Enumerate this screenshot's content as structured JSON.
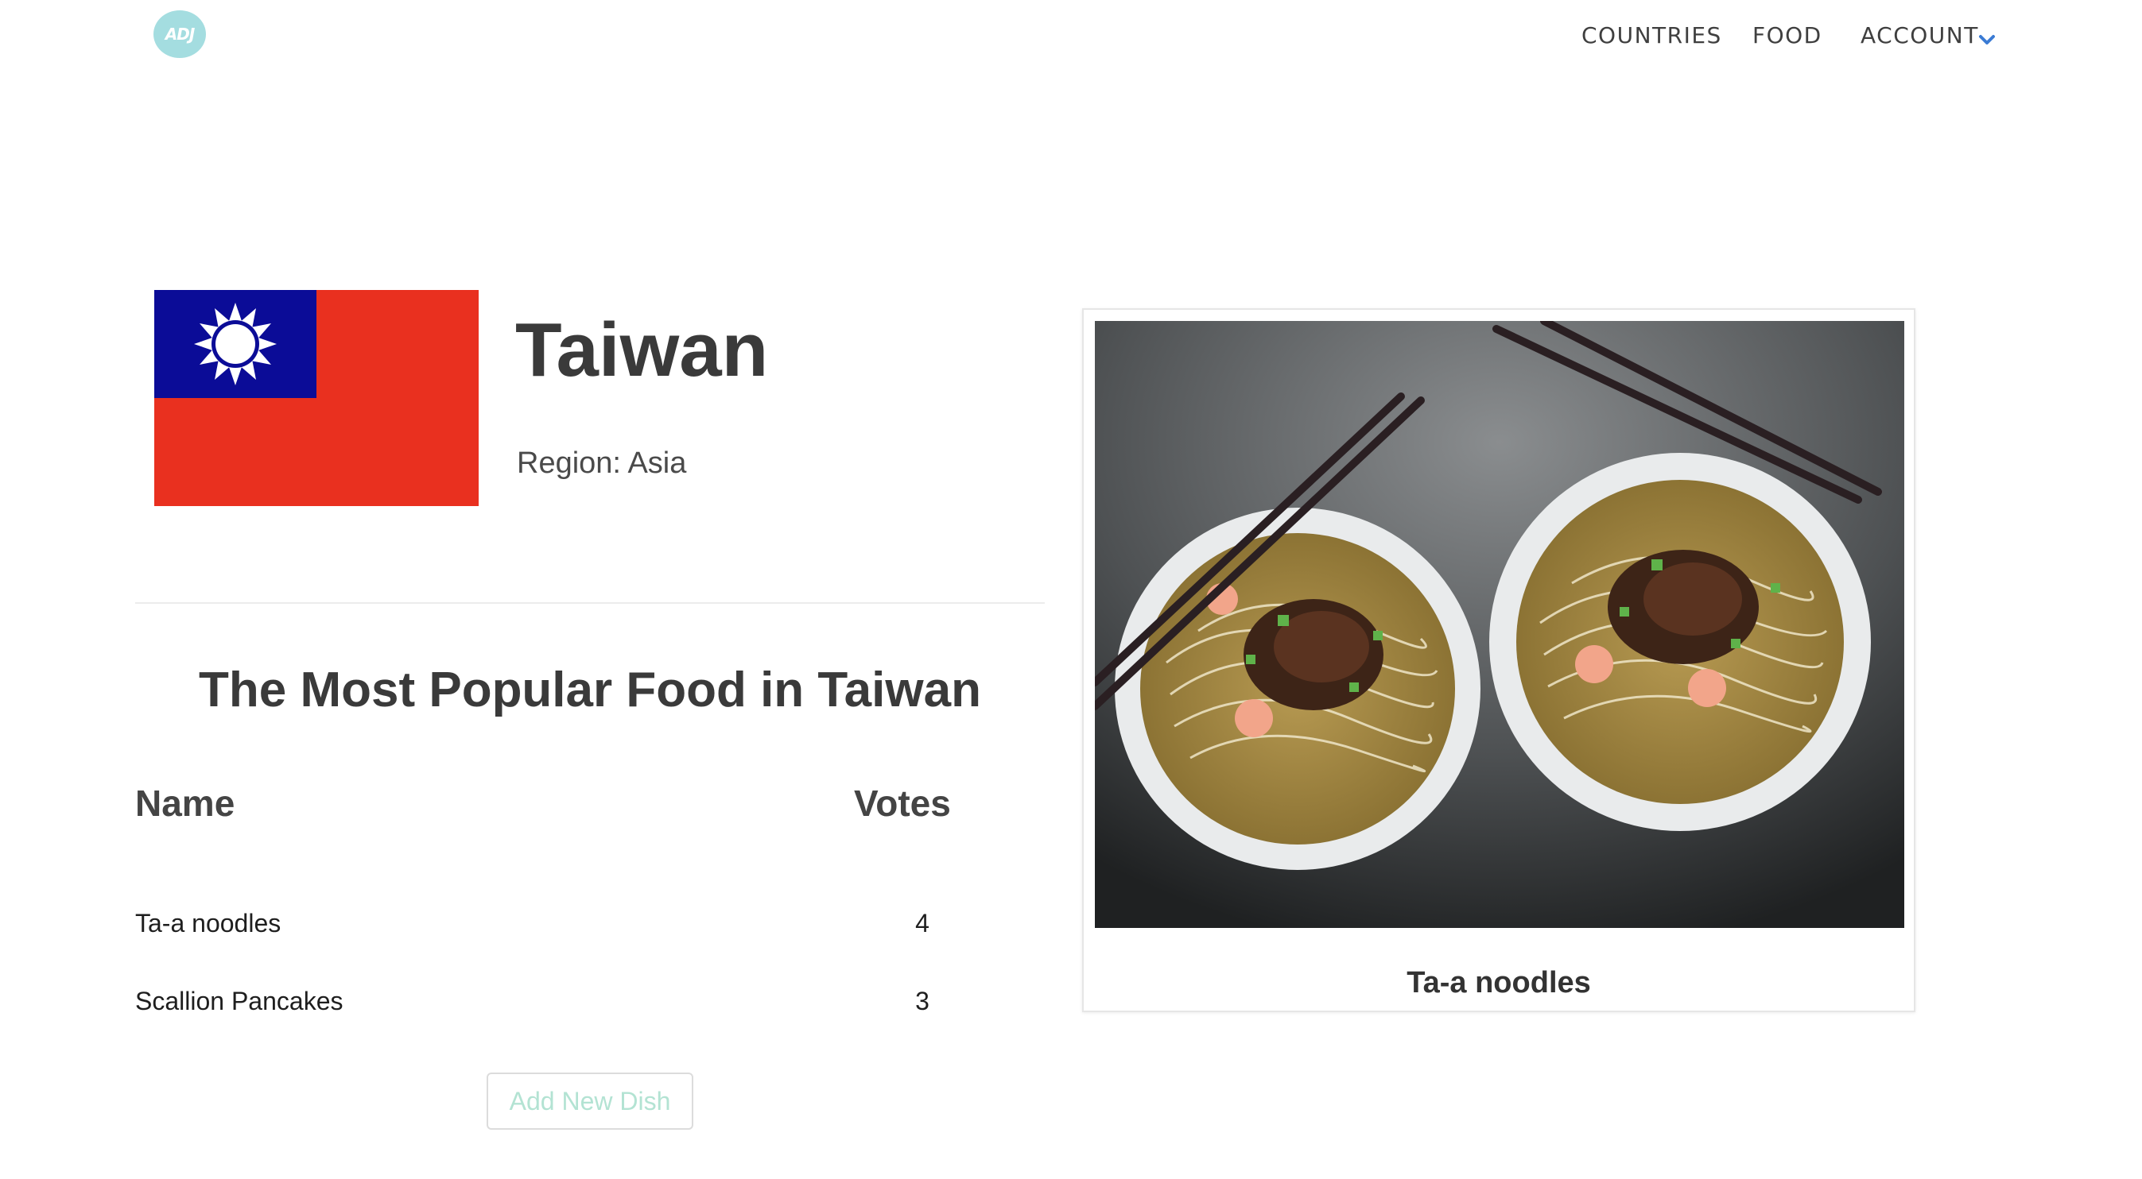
{
  "header": {
    "logo_text": "ADJ",
    "nav": [
      {
        "label": "COUNTRIES"
      },
      {
        "label": "FOOD"
      },
      {
        "label": "ACCOUNT"
      }
    ],
    "accent_color": "#3b7bd4"
  },
  "country": {
    "name": "Taiwan",
    "region_label": "Region:",
    "region_value": "Asia",
    "flag_colors": {
      "field": "#e9301f",
      "canton": "#0b0c97",
      "sun": "#ffffff"
    }
  },
  "popular": {
    "title": "The Most Popular Food in Taiwan",
    "columns": {
      "name": "Name",
      "votes": "Votes"
    },
    "rows": [
      {
        "name": "Ta-a noodles",
        "votes": "4"
      },
      {
        "name": "Scallion Pancakes",
        "votes": "3"
      }
    ],
    "add_button": "Add New Dish"
  },
  "featured": {
    "caption": "Ta-a noodles",
    "image_icon": "noodle-bowls-photo"
  }
}
